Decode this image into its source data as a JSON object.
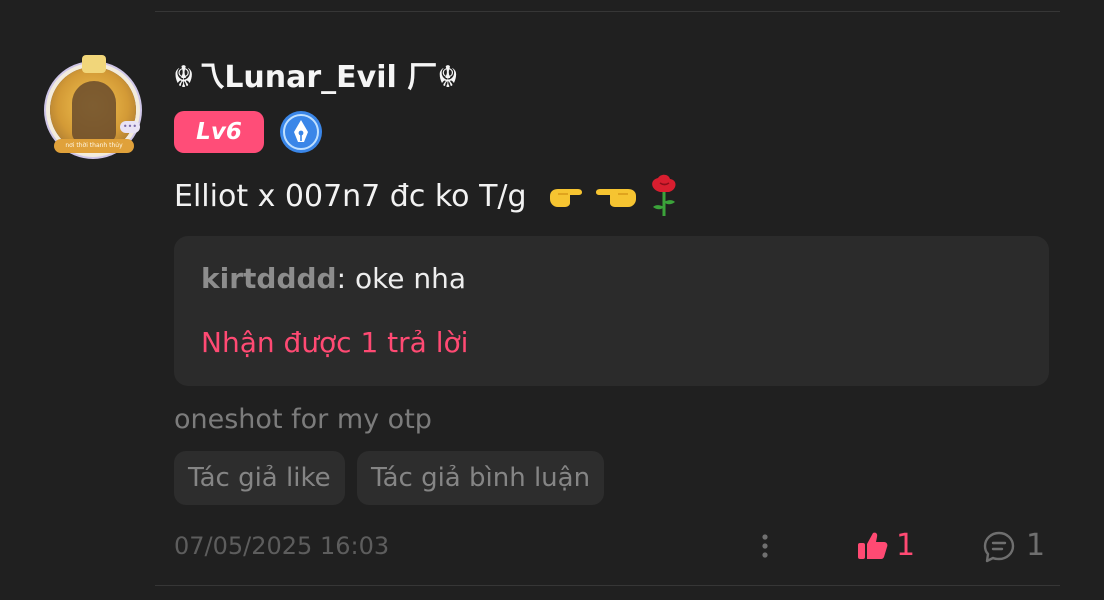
{
  "comment": {
    "author": "☬乁Lunar_Evil 厂☬",
    "level": "Lv6",
    "text": "Elliot x 007n7 đc ko T/g",
    "emojis": [
      "👉",
      "👈",
      "🌹"
    ],
    "tag": "oneshot for my otp",
    "timestamp": "07/05/2025 16:03",
    "likes": "1",
    "replies_count": "1"
  },
  "reply_preview": {
    "author": "kirtdddd",
    "separator": ": ",
    "text": "oke nha",
    "reply_count_label": "Nhận được 1 trả lời"
  },
  "author_actions": {
    "liked_label": "Tác giả like",
    "commented_label": "Tác giả bình luận"
  },
  "avatar": {
    "ribbon_text": "nơi thời thanh thủy",
    "side_badge": "•••"
  },
  "colors": {
    "background": "#202020",
    "accent_pink": "#ff4a73",
    "level_badge": "#ff4d78",
    "creator_badge": "#3a86e8"
  },
  "icons": {
    "creator_badge": "pen-nib-icon",
    "more": "more-vertical-icon",
    "like": "thumbs-up-icon",
    "comment": "comment-bubble-icon"
  }
}
